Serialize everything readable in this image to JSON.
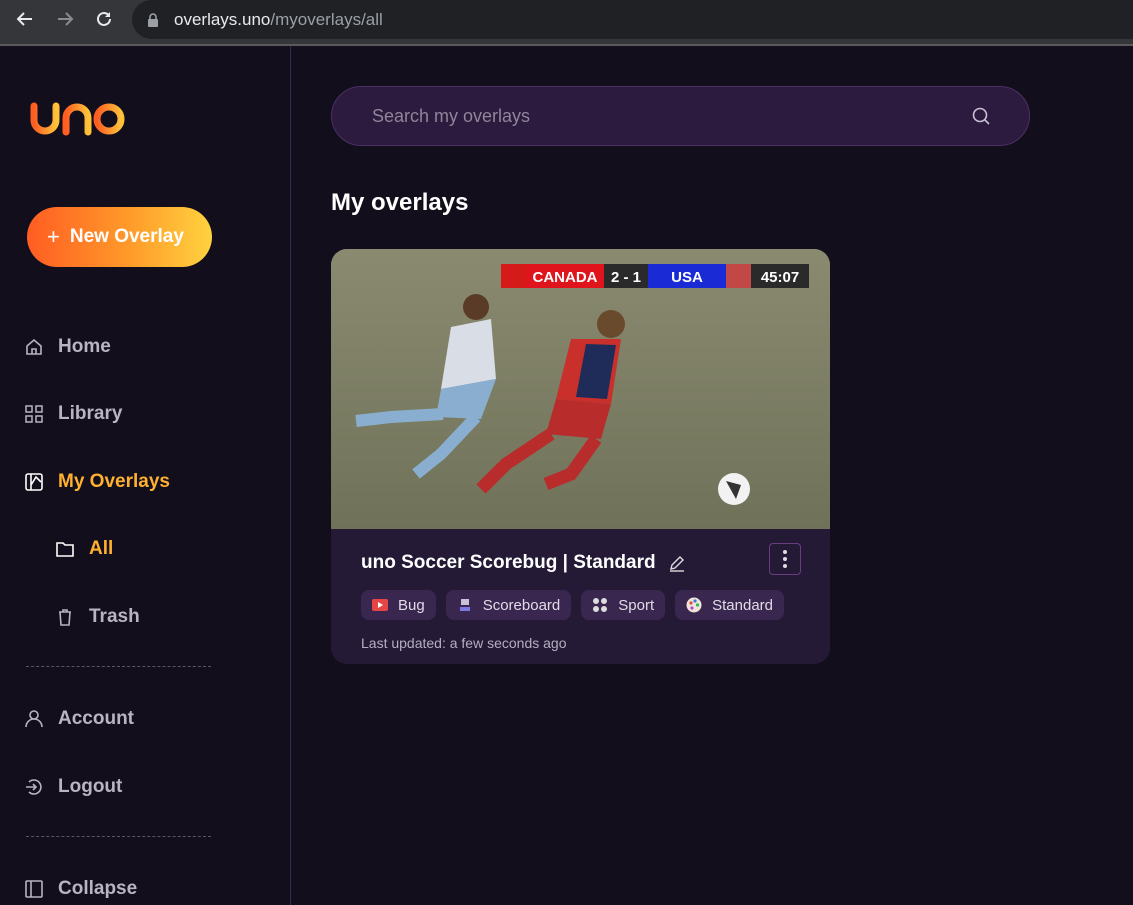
{
  "browser": {
    "url_host": "overlays.uno",
    "url_path": "/myoverlays/all"
  },
  "sidebar": {
    "logo_text": "uno",
    "new_overlay_label": "New Overlay",
    "items": [
      {
        "label": "Home",
        "icon": "home-icon"
      },
      {
        "label": "Library",
        "icon": "grid-icon"
      },
      {
        "label": "My Overlays",
        "icon": "overlays-icon",
        "active": true
      },
      {
        "label": "All",
        "icon": "folder-icon",
        "active": true
      },
      {
        "label": "Trash",
        "icon": "trash-icon"
      },
      {
        "label": "Account",
        "icon": "user-icon"
      },
      {
        "label": "Logout",
        "icon": "logout-icon"
      },
      {
        "label": "Collapse",
        "icon": "sidebar-collapse-icon"
      }
    ]
  },
  "search": {
    "placeholder": "Search my overlays"
  },
  "main": {
    "title": "My overlays"
  },
  "card": {
    "title": "uno Soccer Scorebug | Standard",
    "scorebug": {
      "home": "CANADA",
      "score": "2 - 1",
      "away": "USA",
      "clock": "45:07"
    },
    "tags": [
      {
        "label": "Bug",
        "icon": "play-icon"
      },
      {
        "label": "Scoreboard",
        "icon": "scoreboard-icon"
      },
      {
        "label": "Sport",
        "icon": "sport-icon"
      },
      {
        "label": "Standard",
        "icon": "palette-icon"
      }
    ],
    "updated": "Last updated: a few seconds ago"
  },
  "colors": {
    "accent": "#ffb02e",
    "background": "#120e1c",
    "card": "#241a36"
  }
}
